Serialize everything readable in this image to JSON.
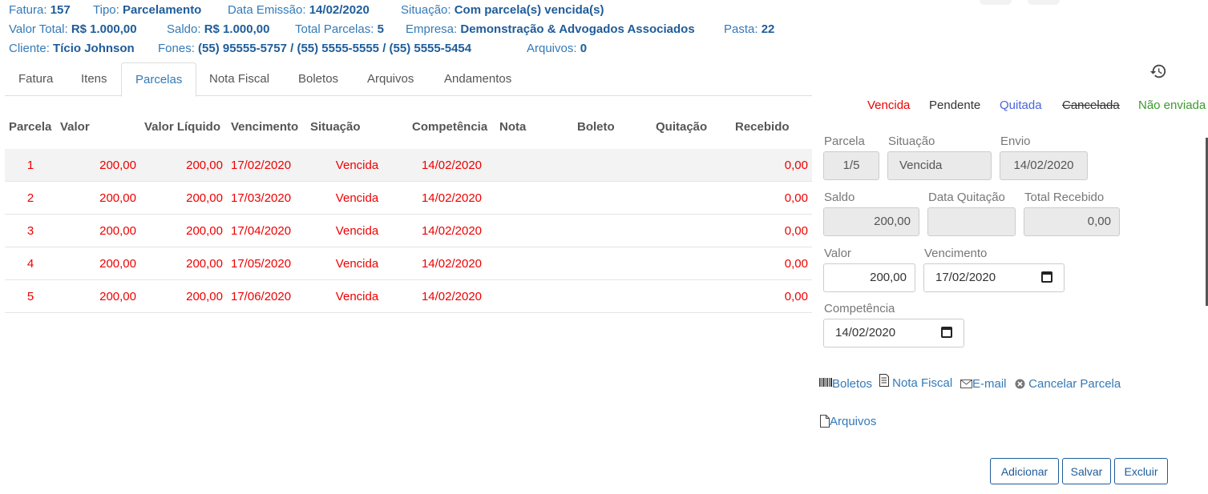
{
  "header": {
    "fatura_label": "Fatura:",
    "fatura_value": "157",
    "tipo_label": "Tipo:",
    "tipo_value": "Parcelamento",
    "emissao_label": "Data Emissão:",
    "emissao_value": "14/02/2020",
    "situacao_label": "Situação:",
    "situacao_value": "Com parcela(s) vencida(s)",
    "valor_total_label": "Valor Total:",
    "valor_total_value": "R$ 1.000,00",
    "saldo_label": "Saldo:",
    "saldo_value": "R$ 1.000,00",
    "total_parcelas_label": "Total Parcelas:",
    "total_parcelas_value": "5",
    "empresa_label": "Empresa:",
    "empresa_value": "Demonstração & Advogados Associados",
    "pasta_label": "Pasta:",
    "pasta_value": "22",
    "cliente_label": "Cliente:",
    "cliente_value": "Tício Johnson",
    "fones_label": "Fones:",
    "fones_value": "(55) 95555-5757 / (55) 5555-5555 / (55) 5555-5454",
    "arquivos_label": "Arquivos:",
    "arquivos_value": "0"
  },
  "tabs": [
    "Fatura",
    "Itens",
    "Parcelas",
    "Nota Fiscal",
    "Boletos",
    "Arquivos",
    "Andamentos"
  ],
  "active_tab": "Parcelas",
  "table": {
    "columns": [
      "Parcela",
      "Valor",
      "Valor Líquido",
      "Vencimento",
      "Situação",
      "Competência",
      "Nota",
      "Boleto",
      "Quitação",
      "Recebido"
    ],
    "rows": [
      {
        "parcela": "1",
        "valor": "200,00",
        "liquido": "200,00",
        "vencimento": "17/02/2020",
        "situacao": "Vencida",
        "competencia": "14/02/2020",
        "nota": "",
        "boleto": "",
        "quitacao": "",
        "recebido": "0,00"
      },
      {
        "parcela": "2",
        "valor": "200,00",
        "liquido": "200,00",
        "vencimento": "17/03/2020",
        "situacao": "Vencida",
        "competencia": "14/02/2020",
        "nota": "",
        "boleto": "",
        "quitacao": "",
        "recebido": "0,00"
      },
      {
        "parcela": "3",
        "valor": "200,00",
        "liquido": "200,00",
        "vencimento": "17/04/2020",
        "situacao": "Vencida",
        "competencia": "14/02/2020",
        "nota": "",
        "boleto": "",
        "quitacao": "",
        "recebido": "0,00"
      },
      {
        "parcela": "4",
        "valor": "200,00",
        "liquido": "200,00",
        "vencimento": "17/05/2020",
        "situacao": "Vencida",
        "competencia": "14/02/2020",
        "nota": "",
        "boleto": "",
        "quitacao": "",
        "recebido": "0,00"
      },
      {
        "parcela": "5",
        "valor": "200,00",
        "liquido": "200,00",
        "vencimento": "17/06/2020",
        "situacao": "Vencida",
        "competencia": "14/02/2020",
        "nota": "",
        "boleto": "",
        "quitacao": "",
        "recebido": "0,00"
      }
    ]
  },
  "legend": {
    "vencida": "Vencida",
    "pendente": "Pendente",
    "quitada": "Quitada",
    "cancelada": "Cancelada",
    "nao_enviada": "Não enviada"
  },
  "form": {
    "parcela_label": "Parcela",
    "parcela_value": "1/5",
    "situacao_label": "Situação",
    "situacao_value": "Vencida",
    "envio_label": "Envio",
    "envio_value": "14/02/2020",
    "saldo_label": "Saldo",
    "saldo_value": "200,00",
    "data_quitacao_label": "Data Quitação",
    "data_quitacao_value": "",
    "total_recebido_label": "Total Recebido",
    "total_recebido_value": "0,00",
    "valor_label": "Valor",
    "valor_value": "200,00",
    "vencimento_label": "Vencimento",
    "vencimento_value": "17/02/2020",
    "competencia_label": "Competência",
    "competencia_value": "14/02/2020"
  },
  "actions": {
    "boletos": "Boletos",
    "nota_fiscal": "Nota Fiscal",
    "email": "E-mail",
    "cancelar": "Cancelar Parcela",
    "arquivos": "Arquivos"
  },
  "buttons": {
    "adicionar": "Adicionar",
    "salvar": "Salvar",
    "excluir": "Excluir"
  },
  "colors": {
    "overdue": "#e00000",
    "link": "#337ab7",
    "header_value": "#1f5c99",
    "pendente": "#333333",
    "nao_enviada": "#3c9a2e"
  }
}
